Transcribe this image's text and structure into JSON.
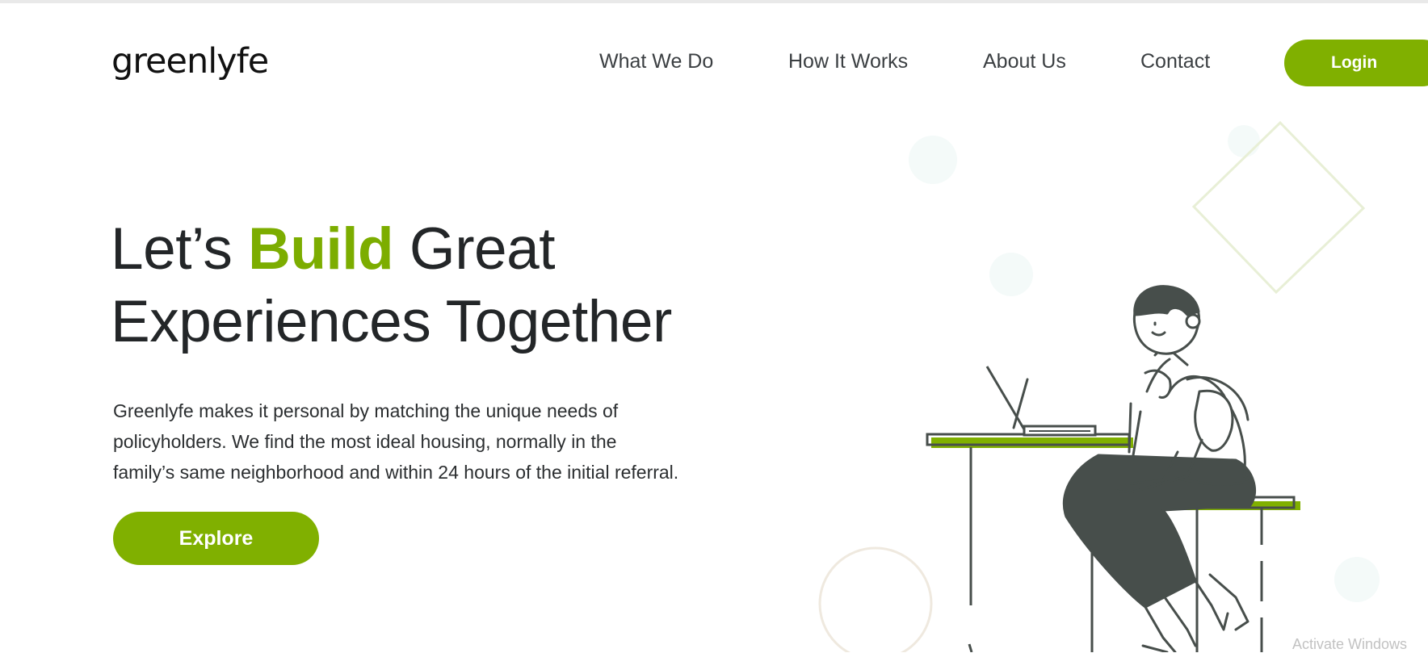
{
  "brand": {
    "logo_text": "greenlyfe"
  },
  "nav": {
    "items": [
      {
        "label": "What We Do"
      },
      {
        "label": "How It Works"
      },
      {
        "label": "About Us"
      },
      {
        "label": "Contact"
      }
    ],
    "login_label": "Login"
  },
  "hero": {
    "headline_part1": "Let’s ",
    "headline_accent": "Build",
    "headline_part2": " Great",
    "headline_line2": "Experiences Together",
    "description_line1": "Greenlyfe makes it personal by matching the unique needs of",
    "description_line2": "policyholders. We find the most ideal housing, normally in the",
    "description_line3": "family’s same neighborhood and within 24 hours of the initial referral.",
    "cta_label": "Explore"
  },
  "overlay": {
    "os_watermark": "Activate Windows"
  },
  "colors": {
    "accent": "#80b000",
    "text": "#232628",
    "illustration_dark": "#474e4b"
  }
}
